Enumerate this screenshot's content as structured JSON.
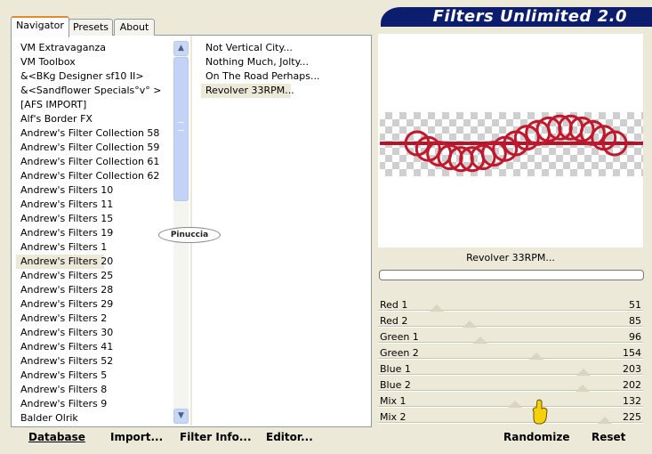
{
  "banner": {
    "title": "Filters Unlimited 2.0"
  },
  "tabs": [
    {
      "label": "Navigator"
    },
    {
      "label": "Presets"
    },
    {
      "label": "About"
    }
  ],
  "categories": [
    "VM Extravaganza",
    "VM Toolbox",
    "&<BKg Designer sf10 II>",
    "&<Sandflower Specials°v° >",
    "[AFS IMPORT]",
    "Alf's Border FX",
    "Andrew's Filter Collection 58",
    "Andrew's Filter Collection 59",
    "Andrew's Filter Collection 61",
    "Andrew's Filter Collection 62",
    "Andrew's Filters 10",
    "Andrew's Filters 11",
    "Andrew's Filters 15",
    "Andrew's Filters 19",
    "Andrew's Filters 1",
    "Andrew's Filters 20",
    "Andrew's Filters 25",
    "Andrew's Filters 28",
    "Andrew's Filters 29",
    "Andrew's Filters 2",
    "Andrew's Filters 30",
    "Andrew's Filters 41",
    "Andrew's Filters 52",
    "Andrew's Filters 5",
    "Andrew's Filters 8",
    "Andrew's Filters 9",
    "Balder Olrik"
  ],
  "selected_category": "Andrew's Filters 20",
  "filters": [
    "Not Vertical City...",
    "Nothing Much, Jolty...",
    "On The Road Perhaps...",
    "Revolver 33RPM..."
  ],
  "selected_filter": "Revolver 33RPM...",
  "watermark": "Pinuccia",
  "bottom_buttons": {
    "database": "Database",
    "import": "Import...",
    "filter_info": "Filter Info...",
    "editor": "Editor..."
  },
  "preview": {
    "filter_name": "Revolver 33RPM...",
    "progress": 0
  },
  "sliders": [
    {
      "label": "Red 1",
      "value": 51
    },
    {
      "label": "Red 2",
      "value": 85
    },
    {
      "label": "Green 1",
      "value": 96
    },
    {
      "label": "Green 2",
      "value": 154
    },
    {
      "label": "Blue 1",
      "value": 203
    },
    {
      "label": "Blue 2",
      "value": 202
    },
    {
      "label": "Mix 1",
      "value": 132
    },
    {
      "label": "Mix 2",
      "value": 225
    }
  ],
  "actions": {
    "randomize": "Randomize",
    "reset": "Reset"
  },
  "colors": {
    "banner": "#0c1d6d",
    "accent_tab": "#e68b2c",
    "rings": "#c0182c"
  }
}
